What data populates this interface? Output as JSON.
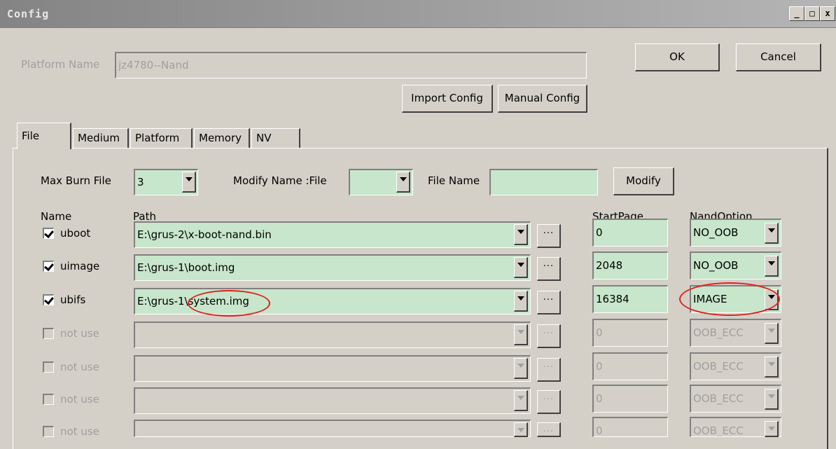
{
  "window": {
    "title": "Config",
    "controls": [
      "_",
      "□",
      "x"
    ]
  },
  "header": {
    "platform_name_label": "Platform Name",
    "platform_name_value": "jz4780--Nand",
    "ok_label": "OK",
    "cancel_label": "Cancel",
    "import_config_label": "Import Config",
    "manual_config_label": "Manual Config"
  },
  "tabs": [
    {
      "label": "File",
      "active": true
    },
    {
      "label": "Medium"
    },
    {
      "label": "Platform"
    },
    {
      "label": "Memory"
    },
    {
      "label": "NV"
    }
  ],
  "file_panel": {
    "max_burn_file_label": "Max Burn File",
    "max_burn_file_value": "3",
    "modify_name_label": "Modify Name  :File",
    "modify_name_value": "",
    "file_name_label": "File Name",
    "file_name_value": "",
    "modify_button_label": "Modify",
    "columns": {
      "name": "Name",
      "path": "Path",
      "start_page": "StartPage",
      "nand_option": "NandOption"
    },
    "browse_label": "...",
    "rows": [
      {
        "name": "uboot",
        "checked": true,
        "enabled": true,
        "path": "E:\\grus-2\\x-boot-nand.bin",
        "start_page": "0",
        "nand_option": "NO_OOB"
      },
      {
        "name": "uimage",
        "checked": true,
        "enabled": true,
        "path": "E:\\grus-1\\boot.img",
        "start_page": "2048",
        "nand_option": "NO_OOB"
      },
      {
        "name": "ubifs",
        "checked": true,
        "enabled": true,
        "path": "E:\\grus-1\\system.img",
        "start_page": "16384",
        "nand_option": "IMAGE"
      },
      {
        "name": "not use",
        "checked": false,
        "enabled": false,
        "path": "",
        "start_page": "0",
        "nand_option": "OOB_ECC"
      },
      {
        "name": "not use",
        "checked": false,
        "enabled": false,
        "path": "",
        "start_page": "0",
        "nand_option": "OOB_ECC"
      },
      {
        "name": "not use",
        "checked": false,
        "enabled": false,
        "path": "",
        "start_page": "0",
        "nand_option": "OOB_ECC"
      },
      {
        "name": "not use",
        "checked": false,
        "enabled": false,
        "path": "",
        "start_page": "0",
        "nand_option": "OOB_ECC"
      }
    ]
  },
  "colors": {
    "window_bg": "#d4d0c8",
    "field_green": "#c7e6cb",
    "highlight_ellipse": "#e0201c"
  }
}
